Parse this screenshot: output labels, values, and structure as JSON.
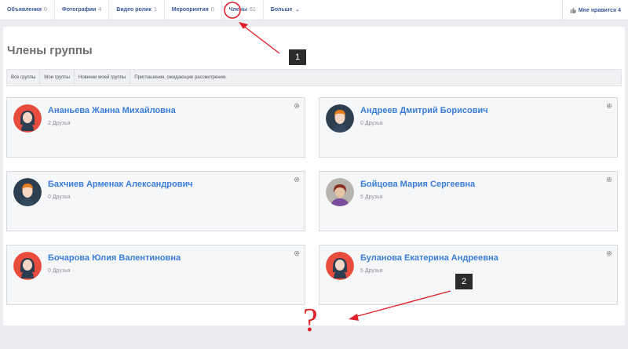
{
  "tabs": [
    {
      "label": "Объявления",
      "count": "0"
    },
    {
      "label": "Фотографии",
      "count": "4"
    },
    {
      "label": "Видео ролик",
      "count": "1"
    },
    {
      "label": "Мероприятия",
      "count": "0"
    },
    {
      "label": "Члены",
      "count": "61"
    },
    {
      "label": "Больше",
      "count": ""
    }
  ],
  "like": {
    "label": "Мне нравится",
    "count": "4"
  },
  "page_title": "Члены группы",
  "subnav": [
    "Все группы",
    "Мои группы",
    "Новинки моей группы",
    "Приглашения, ожидающие рассмотрения."
  ],
  "members": [
    {
      "name": "Ананьева Жанна Михайловна",
      "friends": "2 Друзья",
      "avatar": "female-avatar-icon"
    },
    {
      "name": "Андреев Дмитрий Борисович",
      "friends": "0 Друзья",
      "avatar": "male-avatar-icon"
    },
    {
      "name": "Бахчиев Арменак Александрович",
      "friends": "0 Друзья",
      "avatar": "male-avatar-icon"
    },
    {
      "name": "Бойцова Мария Сергеевна",
      "friends": "5 Друзья",
      "avatar": "photo-avatar"
    },
    {
      "name": "Бочарова Юлия Валентиновна",
      "friends": "0 Друзья",
      "avatar": "female-avatar-icon"
    },
    {
      "name": "Буланова Екатерина Андреевна",
      "friends": "5 Друзья",
      "avatar": "female-avatar-icon"
    }
  ],
  "annotations": {
    "marker1": "1",
    "marker2": "2",
    "question": "?"
  },
  "colors": {
    "accent_link": "#3b7dd8",
    "annotation_red": "#e0202a",
    "avatar_red": "#e74c3c",
    "avatar_navy": "#2c3e50"
  }
}
